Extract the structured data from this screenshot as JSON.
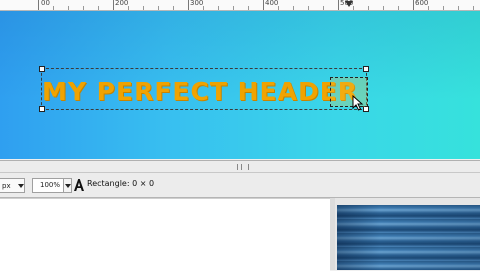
{
  "ruler": {
    "labels": [
      "00",
      "200",
      "300",
      "400",
      "500",
      "600"
    ]
  },
  "canvas": {
    "header_text": "MY PERFECT HEADER",
    "text_color": "#f2a400",
    "gradient_left": "#2f9ff0",
    "gradient_right": "#36e2dc"
  },
  "statusbar": {
    "unit": "px",
    "zoom": "100%",
    "tool_icon": "text-tool-icon",
    "status_message": "Rectangle: 0 × 0"
  },
  "lower_right": {
    "thumbnail": "wood-texture-thumbnail"
  }
}
